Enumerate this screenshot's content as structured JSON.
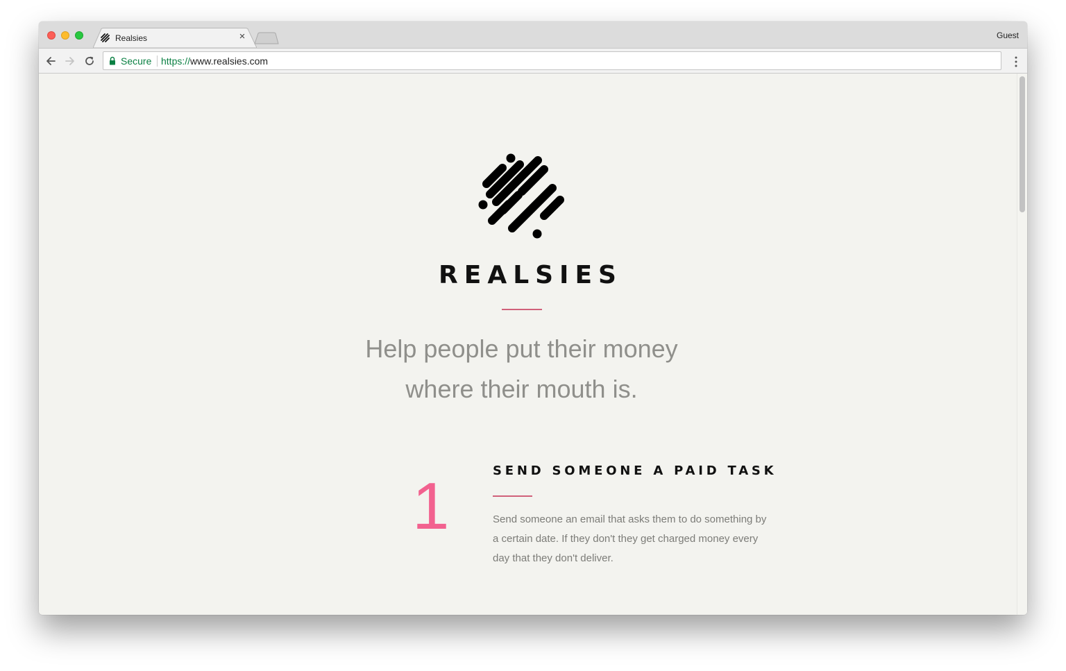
{
  "browser": {
    "tab_title": "Realsies",
    "tab_close_glyph": "×",
    "profile": "Guest",
    "secure_label": "Secure",
    "url_scheme": "https://",
    "url_rest": "www.realsies.com"
  },
  "page": {
    "brand": "REALSIES",
    "tagline_line1": "Help people put their money",
    "tagline_line2": "where their mouth is.",
    "step": {
      "number": "1",
      "title": "SEND SOMEONE A PAID TASK",
      "description": "Send someone an email that asks them to do something by a certain date. If they don't they get charged money every day that they don't deliver."
    }
  },
  "colors": {
    "accent_pink": "#f2618f",
    "divider_rose": "#d0607a",
    "secure_green": "#0b8043",
    "page_background": "#f3f3ef"
  },
  "icons": [
    "back-arrow-icon",
    "forward-arrow-icon",
    "reload-icon",
    "lock-icon",
    "more-menu-icon",
    "realsies-logo-icon",
    "tab-close-icon"
  ]
}
